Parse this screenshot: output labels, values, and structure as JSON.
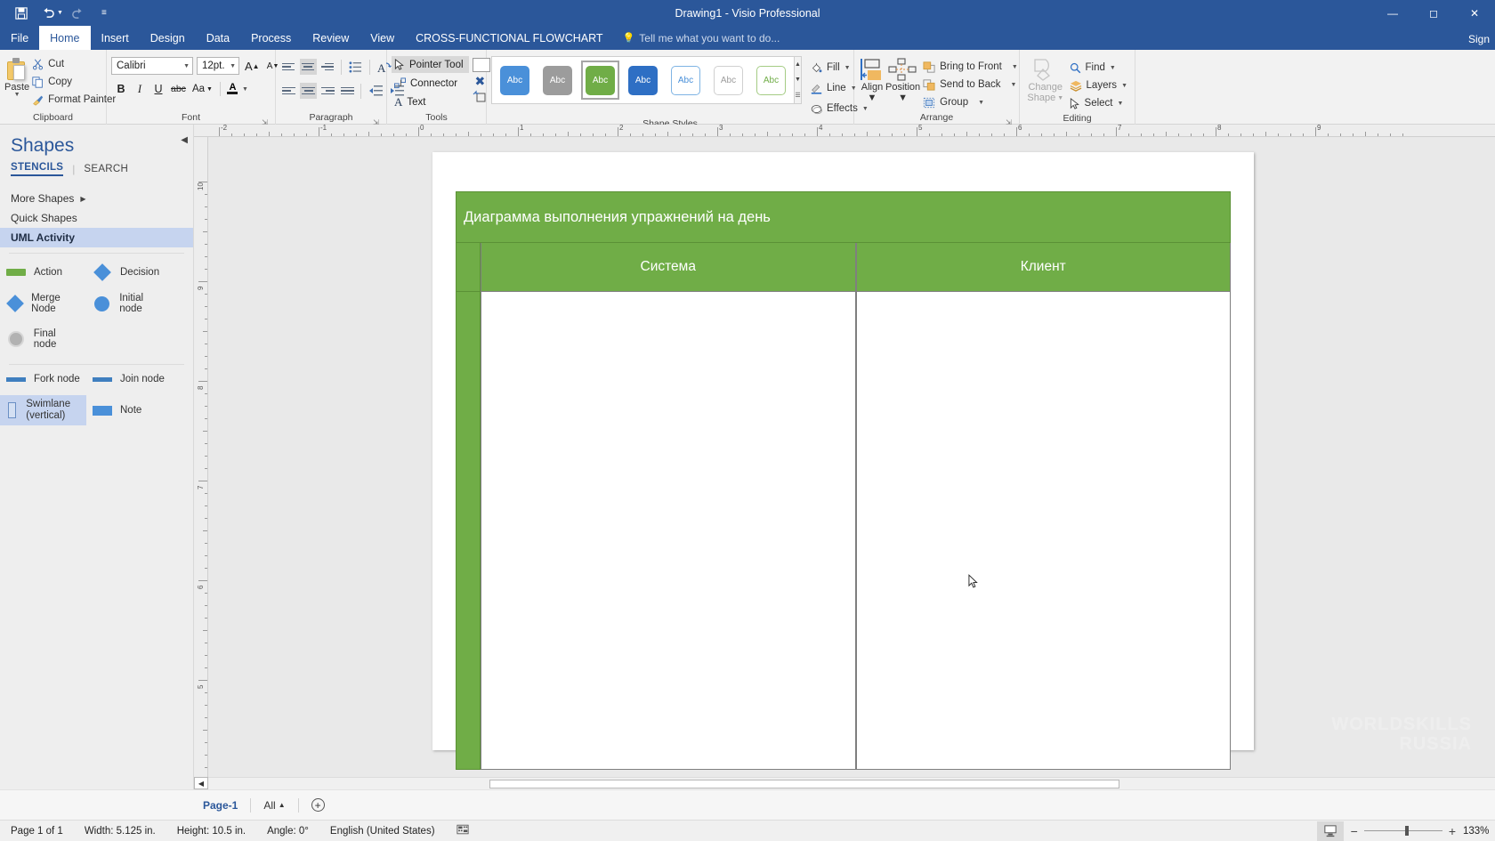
{
  "titlebar": {
    "title": "Drawing1 - Visio Professional",
    "quick_access": [
      {
        "name": "save-icon",
        "glyph": "💾"
      },
      {
        "name": "undo-icon",
        "glyph": "↶"
      },
      {
        "name": "redo-icon",
        "glyph": "↻"
      },
      {
        "name": "customize-qat-icon",
        "glyph": "≡"
      }
    ],
    "window_controls": [
      {
        "name": "minimize-button",
        "glyph": "—"
      },
      {
        "name": "maximize-button",
        "glyph": "☐"
      },
      {
        "name": "close-button",
        "glyph": "✕"
      }
    ]
  },
  "tabs": [
    {
      "label": "File",
      "active": false
    },
    {
      "label": "Home",
      "active": true
    },
    {
      "label": "Insert",
      "active": false
    },
    {
      "label": "Design",
      "active": false
    },
    {
      "label": "Data",
      "active": false
    },
    {
      "label": "Process",
      "active": false
    },
    {
      "label": "Review",
      "active": false
    },
    {
      "label": "View",
      "active": false
    },
    {
      "label": "CROSS-FUNCTIONAL FLOWCHART",
      "active": false
    }
  ],
  "tell_me": "Tell me what you want to do...",
  "signin": "Sign",
  "ribbon": {
    "clipboard": {
      "label": "Clipboard",
      "paste": "Paste",
      "cut": "Cut",
      "copy": "Copy",
      "format_painter": "Format Painter"
    },
    "font": {
      "label": "Font",
      "family": "Calibri",
      "size": "12pt.",
      "grow": "A",
      "shrink": "A",
      "bold": "B",
      "italic": "I",
      "underline": "U",
      "strike": "abc",
      "change_case": "Aa",
      "font_color": "A"
    },
    "paragraph": {
      "label": "Paragraph"
    },
    "tools": {
      "label": "Tools",
      "pointer": "Pointer Tool",
      "connector": "Connector",
      "text": "Text"
    },
    "shape_styles": {
      "label": "Shape Styles",
      "swatch_text": "Abc",
      "swatches": [
        {
          "fill": "#4a90d9",
          "text": "#ffffff",
          "border": "#4a90d9",
          "selected": false
        },
        {
          "fill": "#9c9c9c",
          "text": "#ffffff",
          "border": "#9c9c9c",
          "selected": false
        },
        {
          "fill": "#70ad47",
          "text": "#ffffff",
          "border": "#70ad47",
          "selected": true
        },
        {
          "fill": "#2e6fc4",
          "text": "#ffffff",
          "border": "#2e6fc4",
          "selected": false
        },
        {
          "fill": "#ffffff",
          "text": "#4a90d9",
          "border": "#7fb4e4",
          "selected": false
        },
        {
          "fill": "#ffffff",
          "text": "#9c9c9c",
          "border": "#d0d0d0",
          "selected": false
        },
        {
          "fill": "#ffffff",
          "text": "#70ad47",
          "border": "#a5cc85",
          "selected": false
        }
      ],
      "fill": "Fill",
      "line": "Line",
      "effects": "Effects"
    },
    "arrange": {
      "label": "Arrange",
      "align": "Align",
      "position": "Position",
      "bring_to_front": "Bring to Front",
      "send_to_back": "Send to Back",
      "group": "Group"
    },
    "editing": {
      "label": "Editing",
      "change_shape": "Change",
      "change_shape2": "Shape",
      "find": "Find",
      "layers": "Layers",
      "select": "Select"
    }
  },
  "shapes_panel": {
    "title": "Shapes",
    "tab_stencils": "STENCILS",
    "tab_search": "SEARCH",
    "more_shapes": "More Shapes",
    "quick_shapes": "Quick Shapes",
    "active_stencil": "UML Activity",
    "stencil_items": [
      {
        "label": "Action",
        "icon": "action-bar-icon",
        "selected": false
      },
      {
        "label": "Decision",
        "icon": "diamond-icon",
        "selected": false
      },
      {
        "label": "Merge Node",
        "icon": "diamond-icon",
        "selected": false
      },
      {
        "label": "Initial node",
        "icon": "circle-icon",
        "selected": false
      },
      {
        "label": "Final node",
        "icon": "final-circle-icon",
        "selected": false
      },
      {
        "label": "Fork node",
        "icon": "bar-icon",
        "selected": false
      },
      {
        "label": "Join node",
        "icon": "bar-icon",
        "selected": false
      },
      {
        "label": "Swimlane (vertical)",
        "icon": "swimlane-icon",
        "selected": true
      },
      {
        "label": "Note",
        "icon": "note-icon",
        "selected": false
      }
    ]
  },
  "rulers": {
    "horizontal_ticks": [
      "-2",
      "-1",
      "0",
      "1",
      "2",
      "3",
      "4",
      "5",
      "6",
      "7",
      "8",
      "9"
    ],
    "vertical_ticks": [
      "10",
      "9",
      "8",
      "7",
      "6",
      "5"
    ]
  },
  "diagram": {
    "title": "Диаграмма выполнения упражнений на день",
    "lanes": [
      {
        "label": "Система"
      },
      {
        "label": "Клиент"
      }
    ],
    "header_color": "#70ad47",
    "body_color": "#ffffff"
  },
  "pagebar": {
    "page_tab": "Page-1",
    "all": "All",
    "add": "+"
  },
  "statusbar": {
    "page_of": "Page 1 of 1",
    "width": "Width: 5.125 in.",
    "height": "Height: 10.5 in.",
    "angle": "Angle: 0°",
    "language": "English (United States)",
    "zoom": "133%",
    "zoom_out": "−",
    "zoom_in": "+"
  },
  "watermark": "WORLDSKILLS\nRUSSIA"
}
